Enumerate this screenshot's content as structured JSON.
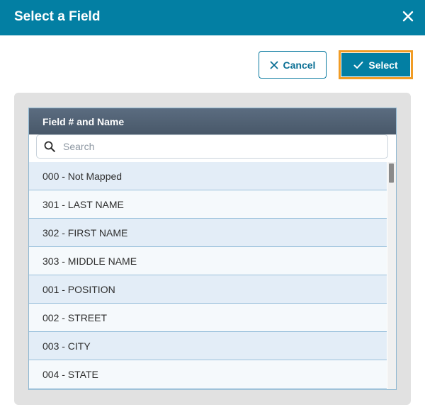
{
  "dialog": {
    "title": "Select a Field",
    "close_icon": "close-icon"
  },
  "actions": {
    "cancel_label": "Cancel",
    "cancel_icon": "x-icon",
    "select_label": "Select",
    "select_icon": "check-icon"
  },
  "colors": {
    "header_bg": "#037fa3",
    "focus_outline": "#f19c25",
    "grid_header_bg": "#4f6073",
    "row_odd": "#e3edf7",
    "row_even": "#f5f9fc"
  },
  "grid": {
    "column_header": "Field # and Name",
    "search_placeholder": "Search",
    "search_icon": "search-icon",
    "rows": [
      "000 - Not Mapped",
      "301 - LAST NAME",
      "302 - FIRST NAME",
      "303 - MIDDLE NAME",
      "001 - POSITION",
      "002 - STREET",
      "003 - CITY",
      "004 - STATE"
    ]
  }
}
